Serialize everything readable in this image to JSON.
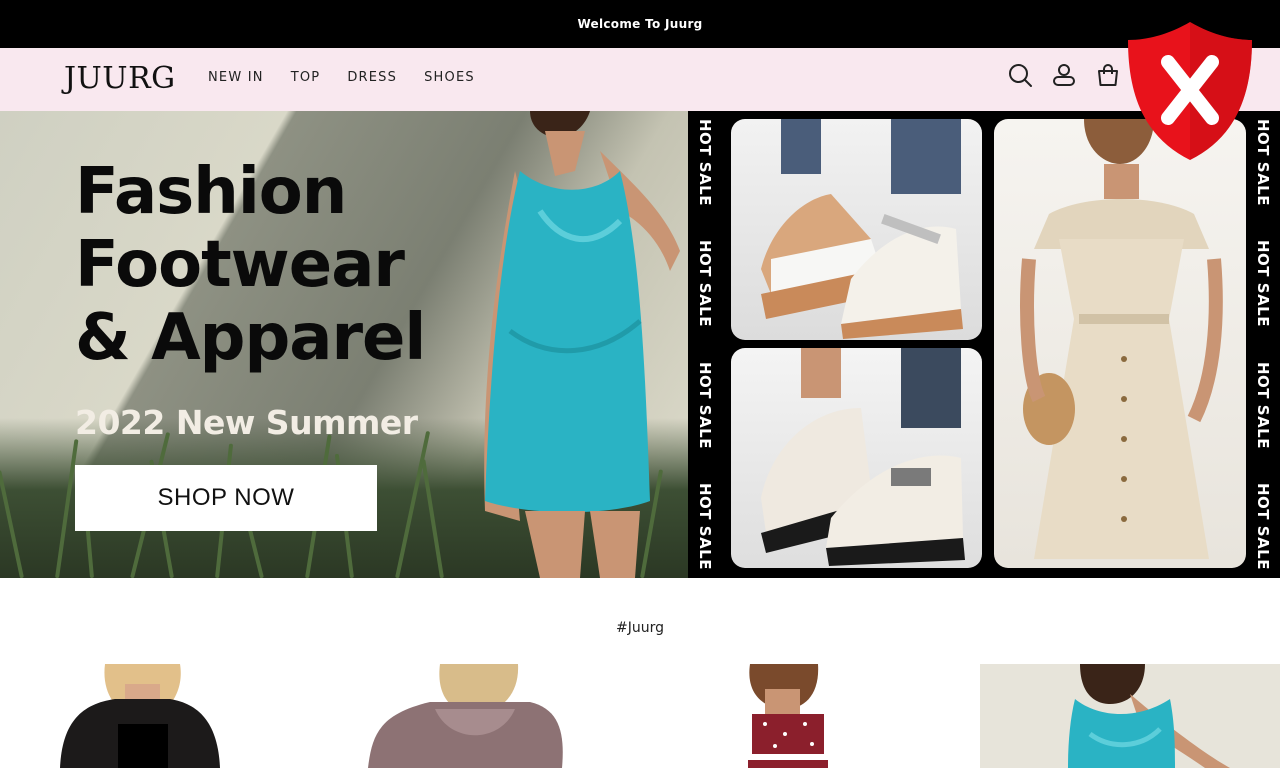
{
  "announcement": "Welcome To Juurg",
  "header": {
    "logo": "JUURG",
    "nav": [
      "NEW IN",
      "TOP",
      "DRESS",
      "SHOES"
    ],
    "icons": [
      "search-icon",
      "account-icon",
      "cart-icon"
    ]
  },
  "overlay": {
    "icon": "shield-x-icon",
    "color": "#e8121b"
  },
  "hero": {
    "title": "Fashion\nFootwear\n& Apparel",
    "subtitle": "2022 New Summer",
    "cta": "SHOP NOW",
    "side_label": "HOT SALE",
    "side_labels": [
      "HOT SALE",
      "HOT SALE",
      "HOT SALE",
      "HOT SALE"
    ]
  },
  "section": {
    "tag": "#Juurg"
  },
  "products": [
    {
      "name": "product-black-mesh-top"
    },
    {
      "name": "product-mauve-lace-top"
    },
    {
      "name": "product-red-polka-dot-set"
    },
    {
      "name": "product-teal-satin-dress"
    }
  ],
  "colors": {
    "accent_bar": "#000000",
    "header_bg": "#f9e8ef",
    "teal_dress": "#2ab3c4"
  }
}
